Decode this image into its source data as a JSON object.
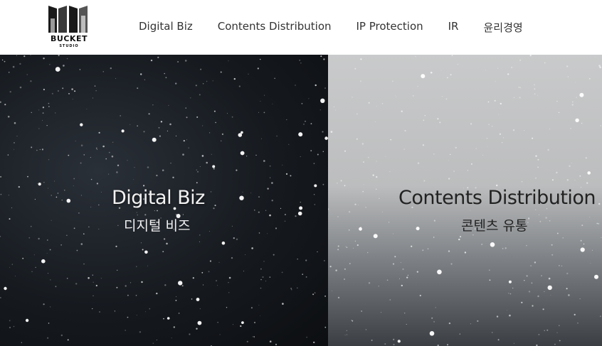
{
  "header": {
    "logo": {
      "word": "BUCKET",
      "sub": "STUDIO"
    },
    "nav": [
      {
        "label": "Digital Biz"
      },
      {
        "label": "Contents Distribution"
      },
      {
        "label": "IP Protection"
      },
      {
        "label": "IR"
      },
      {
        "label": "윤리경영"
      }
    ]
  },
  "hero": {
    "left": {
      "title": "Digital Biz",
      "subtitle": "디지털 비즈"
    },
    "right": {
      "title": "Contents Distribution",
      "subtitle": "콘텐츠 유통"
    }
  }
}
